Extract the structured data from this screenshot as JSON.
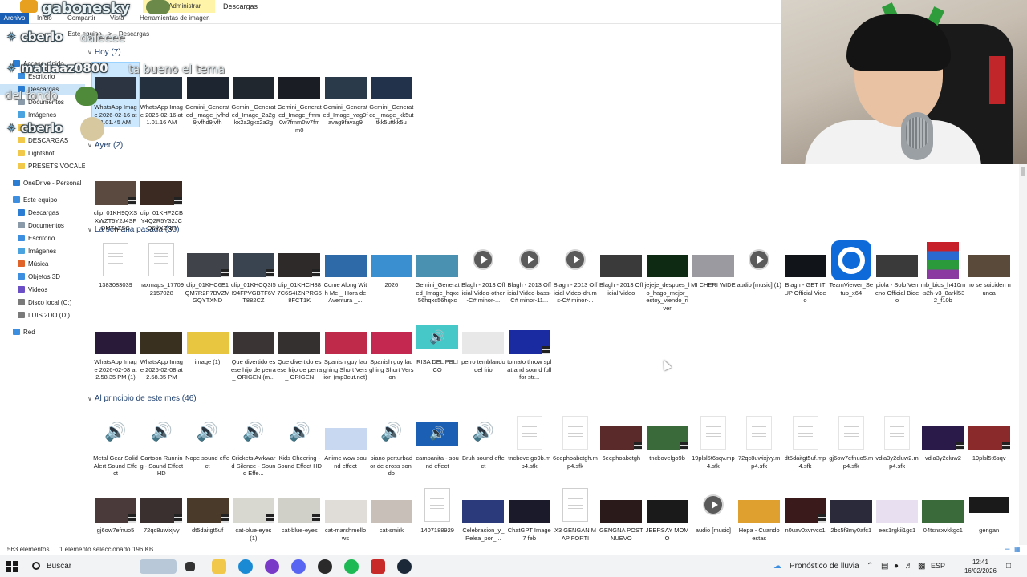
{
  "ribbon": {
    "archivo": "Archivo",
    "tabs": [
      "Inicio",
      "Compartir",
      "Vista",
      "Herramientas de imagen"
    ],
    "context_label": "Administrar",
    "window_title": "Descargas"
  },
  "address": {
    "path": [
      "Este equipo",
      ">",
      "Descargas"
    ]
  },
  "overlays": {
    "channel_name": "gabonesky",
    "chat": [
      {
        "user": "cberlo",
        "msg": "daleeee"
      },
      {
        "user": "matiaaz0800",
        "msg": "ta bueno el tema"
      },
      {
        "user": "",
        "msg": "del fondo"
      },
      {
        "user": "cberlo",
        "msg": ""
      }
    ]
  },
  "nav": [
    {
      "label": "Acceso rápido",
      "icon": "star-icon",
      "color": "#2b7cd3",
      "indent": 0
    },
    {
      "label": "Escritorio",
      "icon": "desktop-icon",
      "color": "#3b8ee0",
      "indent": 1
    },
    {
      "label": "Descargas",
      "icon": "download-icon",
      "color": "#2b7cd3",
      "indent": 1,
      "selected": true
    },
    {
      "label": "Documentos",
      "icon": "document-icon",
      "color": "#8a9aa8",
      "indent": 1
    },
    {
      "label": "Imágenes",
      "icon": "image-icon",
      "color": "#4aa3df",
      "indent": 1
    },
    {
      "label": "2026",
      "icon": "folder-icon",
      "color": "#f2c84b",
      "indent": 1
    },
    {
      "label": "DESCARGAS",
      "icon": "folder-icon",
      "color": "#f2c84b",
      "indent": 1
    },
    {
      "label": "Lightshot",
      "icon": "folder-icon",
      "color": "#f2c84b",
      "indent": 1
    },
    {
      "label": "PRESETS VOCALES F",
      "icon": "folder-icon",
      "color": "#f2c84b",
      "indent": 1
    },
    {
      "label": "OneDrive - Personal",
      "icon": "cloud-icon",
      "color": "#2b7cd3",
      "indent": 0
    },
    {
      "label": "Este equipo",
      "icon": "pc-icon",
      "color": "#3b8ee0",
      "indent": 0
    },
    {
      "label": "Descargas",
      "icon": "download-icon",
      "color": "#2b7cd3",
      "indent": 1
    },
    {
      "label": "Documentos",
      "icon": "document-icon",
      "color": "#8a9aa8",
      "indent": 1
    },
    {
      "label": "Escritorio",
      "icon": "desktop-icon",
      "color": "#3b8ee0",
      "indent": 1
    },
    {
      "label": "Imágenes",
      "icon": "image-icon",
      "color": "#4aa3df",
      "indent": 1
    },
    {
      "label": "Música",
      "icon": "music-icon",
      "color": "#e0632a",
      "indent": 1
    },
    {
      "label": "Objetos 3D",
      "icon": "cube-icon",
      "color": "#3b8ee0",
      "indent": 1
    },
    {
      "label": "Videos",
      "icon": "video-icon",
      "color": "#6a4fc6",
      "indent": 1
    },
    {
      "label": "Disco local (C:)",
      "icon": "drive-icon",
      "color": "#7a7a7a",
      "indent": 1
    },
    {
      "label": "LUIS 2DO (D:)",
      "icon": "drive-icon",
      "color": "#7a7a7a",
      "indent": 1
    },
    {
      "label": "Red",
      "icon": "network-icon",
      "color": "#3b8ee0",
      "indent": 0
    }
  ],
  "groups": [
    {
      "label": "Hoy (7)"
    },
    {
      "label": "Ayer (2)"
    },
    {
      "label": "La semana pasada (30)"
    },
    {
      "label": "Al principio de este mes (46)"
    }
  ],
  "files_hoy": [
    {
      "name": "WhatsApp Image 2026-02-16 at 1.01.45 AM",
      "kind": "photo",
      "color": "#2b3440",
      "selected": true
    },
    {
      "name": "WhatsApp Image 2026-02-16 at 1.01.16 AM",
      "kind": "photo",
      "color": "#24303d"
    },
    {
      "name": "Gemini_Generated_Image_jvfhd9jvfhd9jvfh",
      "kind": "photo",
      "color": "#1d2530"
    },
    {
      "name": "Gemini_Generated_Image_2a2gkx2a2gkx2a2g",
      "kind": "photo",
      "color": "#20272f"
    },
    {
      "name": "Gemini_Generated_Image_fmm0w7fmm0w7fmm0",
      "kind": "photo",
      "color": "#1a1e24"
    },
    {
      "name": "Gemini_Generated_Image_vag9favag9favag9",
      "kind": "photo",
      "color": "#2a3a4a"
    },
    {
      "name": "Gemini_Generated_Image_kk5uttkk5uttkk5u",
      "kind": "photo",
      "color": "#22324a"
    }
  ],
  "files_ayer": [
    {
      "name": "clip_01KH9QXSXWZT5Y2J4SFDMTAZSG",
      "kind": "clip",
      "color": "#5a4a40"
    },
    {
      "name": "clip_01KHF2CBY4Q2R5Y32JCQ6VXZNH",
      "kind": "clip",
      "color": "#3a2a22"
    }
  ],
  "files_semana_1": [
    {
      "name": "1383083039",
      "kind": "doc"
    },
    {
      "name": "haxmaps_177092157028",
      "kind": "doc"
    },
    {
      "name": "clip_01KHC6E1QM7R2P7BVZMGQYTXND",
      "kind": "clip",
      "color": "#40444a"
    },
    {
      "name": "clip_01KHCQ3I5I94FPVGBTF6VT882CZ",
      "kind": "clip",
      "color": "#3a4450"
    },
    {
      "name": "clip_01KHCH887C6S4IZNPRG58FCT1K",
      "kind": "clip",
      "color": "#2e2a2a"
    },
    {
      "name": "Come Along With Me _ Hora de Aventura _...",
      "kind": "photo",
      "color": "#2f6aa8"
    },
    {
      "name": "2026",
      "kind": "photo",
      "color": "#3a8fd0"
    },
    {
      "name": "Gemini_Generated_Image_hqxc56hqxc56hqxc",
      "kind": "photo",
      "color": "#4a90b0"
    },
    {
      "name": "Blagh - 2013 Official Video-other-C# minor-...",
      "kind": "play"
    },
    {
      "name": "Blagh - 2013 Official Video-bass-C# minor-11...",
      "kind": "play"
    },
    {
      "name": "Blagh - 2013 Official Video-drums-C# minor-...",
      "kind": "play"
    },
    {
      "name": "Blagh - 2013 Official Video",
      "kind": "photo",
      "color": "#3a3a3a"
    },
    {
      "name": "jejeje_despues_lo_hago_mejor_estoy_viendo_river",
      "kind": "photo",
      "color": "#0f2a12"
    },
    {
      "name": "MI CHERI WIDE",
      "kind": "photo",
      "color": "#9a9aa0"
    },
    {
      "name": "audio [music] (1)",
      "kind": "play"
    },
    {
      "name": "Blagh - GET IT UP Official Video",
      "kind": "photo",
      "color": "#111418"
    },
    {
      "name": "TeamViewer_Setup_x64",
      "kind": "teamviewer"
    },
    {
      "name": "piola - Solo Veneno Official Bideo",
      "kind": "photo",
      "color": "#3a3a3a"
    },
    {
      "name": "mb_bios_h410m-s2h-v3_8arkl532_f10b",
      "kind": "winrar"
    },
    {
      "name": "no se suiciden nunca",
      "kind": "photo",
      "color": "#5a4a3a"
    }
  ],
  "files_semana_2": [
    {
      "name": "WhatsApp Image 2026-02-08 at 2.58.35 PM (1)",
      "kind": "photo",
      "color": "#2a1a3a"
    },
    {
      "name": "WhatsApp Image 2026-02-08 at 2.58.35 PM",
      "kind": "photo",
      "color": "#3a3020"
    },
    {
      "name": "image (1)",
      "kind": "photo",
      "color": "#e8c640"
    },
    {
      "name": "Que divertido es ese hijo de perra_ ORIGEN (m...",
      "kind": "photo",
      "color": "#3a3434"
    },
    {
      "name": "Que divertido es ese hijo de perra_ ORIGEN",
      "kind": "photo",
      "color": "#343030"
    },
    {
      "name": "Spanish guy laughing Short Version (mp3cut.net)",
      "kind": "photo",
      "color": "#c02a4a"
    },
    {
      "name": "Spanish guy laughing Short Version",
      "kind": "photo",
      "color": "#c42850"
    },
    {
      "name": "RISA DEL PBLICO",
      "kind": "audio-teal"
    },
    {
      "name": "perro temblando del frio",
      "kind": "photo",
      "color": "#e8e8e8"
    },
    {
      "name": "tomato throw splat and sound full for str...",
      "kind": "clip",
      "color": "#1a2aa0"
    }
  ],
  "files_mes_1": [
    {
      "name": "Metal Gear Solid Alert Sound Effect",
      "kind": "speaker"
    },
    {
      "name": "Cartoon Running - Sound Effect HD",
      "kind": "speaker"
    },
    {
      "name": "Nope sound effect",
      "kind": "speaker"
    },
    {
      "name": "Crickets Awkward Silence - Sound Effe...",
      "kind": "speaker"
    },
    {
      "name": "Kids Cheering - Sound Effect HD",
      "kind": "speaker"
    },
    {
      "name": "Anime wow sound effect",
      "kind": "photo",
      "color": "#c8d8f0"
    },
    {
      "name": "piano perturbador de dross sonido",
      "kind": "speaker"
    },
    {
      "name": "campanita - sound effect",
      "kind": "audio-blue"
    },
    {
      "name": "Bruh sound effect",
      "kind": "speaker"
    },
    {
      "name": "tncbovelgo9b.mp4.sfk",
      "kind": "blank"
    },
    {
      "name": "6eephoabctgh.mp4.sfk",
      "kind": "blank"
    },
    {
      "name": "6eephoabctgh",
      "kind": "clip",
      "color": "#5a2a2a"
    },
    {
      "name": "tncbovelgo9b",
      "kind": "clip",
      "color": "#3a6a3a"
    },
    {
      "name": "19plsl5t6sqv.mp4.sfk",
      "kind": "blank"
    },
    {
      "name": "72qc8uwixjvy.mp4.sfk",
      "kind": "blank"
    },
    {
      "name": "dt5daitgt5uf.mp4.sfk",
      "kind": "blank"
    },
    {
      "name": "gj6ow7efnuo5.mp4.sfk",
      "kind": "blank"
    },
    {
      "name": "vdia3y2cluw2.mp4.sfk",
      "kind": "blank"
    },
    {
      "name": "vdia3y2cluw2",
      "kind": "clip",
      "color": "#2a1a4a"
    },
    {
      "name": "19plsl5t6sqv",
      "kind": "clip",
      "color": "#8a2a2a"
    }
  ],
  "files_mes_2": [
    {
      "name": "gj6ow7efnuo5",
      "kind": "clip",
      "color": "#4a3a3a"
    },
    {
      "name": "72qc8uwixjvy",
      "kind": "clip",
      "color": "#3a3030"
    },
    {
      "name": "dt5daitgt5uf",
      "kind": "clip",
      "color": "#4a3a2a"
    },
    {
      "name": "cat-blue-eyes (1)",
      "kind": "clip",
      "color": "#d8d8d0"
    },
    {
      "name": "cat-blue-eyes",
      "kind": "clip",
      "color": "#d0d0c8"
    },
    {
      "name": "cat-marshmellows",
      "kind": "photo",
      "color": "#e0dcd8"
    },
    {
      "name": "cat-smirk",
      "kind": "photo",
      "color": "#c8c0b8"
    },
    {
      "name": "1407188929",
      "kind": "doc"
    },
    {
      "name": "Celebracion_y_Pelea_por_...",
      "kind": "photo",
      "color": "#2a3a7a"
    },
    {
      "name": "ChatGPT Image 7 feb",
      "kind": "photo",
      "color": "#1a1a2a"
    },
    {
      "name": "X3 GENGAN MAP FORTI",
      "kind": "doc"
    },
    {
      "name": "GENGNA POST NUEVO",
      "kind": "photo",
      "color": "#2a1a1a"
    },
    {
      "name": "JEERSAY MOMO",
      "kind": "photo",
      "color": "#1a1a1a"
    },
    {
      "name": "audio [music]",
      "kind": "play"
    },
    {
      "name": "Hepa - Cuando estas",
      "kind": "photo",
      "color": "#e0a030"
    },
    {
      "name": "n0uav0xvrvcc1",
      "kind": "clip",
      "color": "#3a1a1a"
    },
    {
      "name": "2bs5f3my0afc1",
      "kind": "photo",
      "color": "#2a2a3a"
    },
    {
      "name": "ees1rgkii1gc1",
      "kind": "photo",
      "color": "#e8e0f0"
    },
    {
      "name": "04tsnsxvkkgc1",
      "kind": "photo",
      "color": "#3a6a3a"
    },
    {
      "name": "gengan",
      "kind": "gengan"
    }
  ],
  "status": {
    "count": "563 elementos",
    "selected": "1 elemento seleccionado",
    "size": "196 KB"
  },
  "taskbar": {
    "search": "Buscar",
    "weather": "Pronóstico de lluvia",
    "lang": "ESP",
    "time": "12:41",
    "date": "16/02/2026"
  }
}
